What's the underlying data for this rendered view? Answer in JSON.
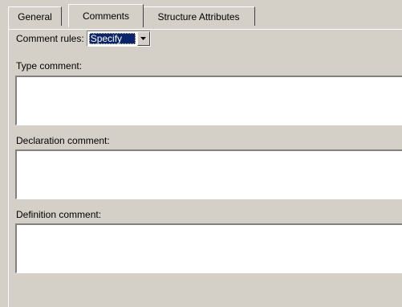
{
  "tabs": [
    {
      "label": "General"
    },
    {
      "label": "Comments"
    },
    {
      "label": "Structure Attributes"
    }
  ],
  "comment_rules": {
    "label": "Comment rules:",
    "selected": "Specify"
  },
  "fields": {
    "type_comment": {
      "label": "Type comment:",
      "value": ""
    },
    "declaration_comment": {
      "label": "Declaration comment:",
      "value": ""
    },
    "definition_comment": {
      "label": "Definition comment:",
      "value": ""
    }
  },
  "icons": {
    "dropdown": "chevron-down-icon"
  },
  "colors": {
    "panel": "#d4d0c8",
    "selection": "#0a246a",
    "field": "#ffffff"
  }
}
